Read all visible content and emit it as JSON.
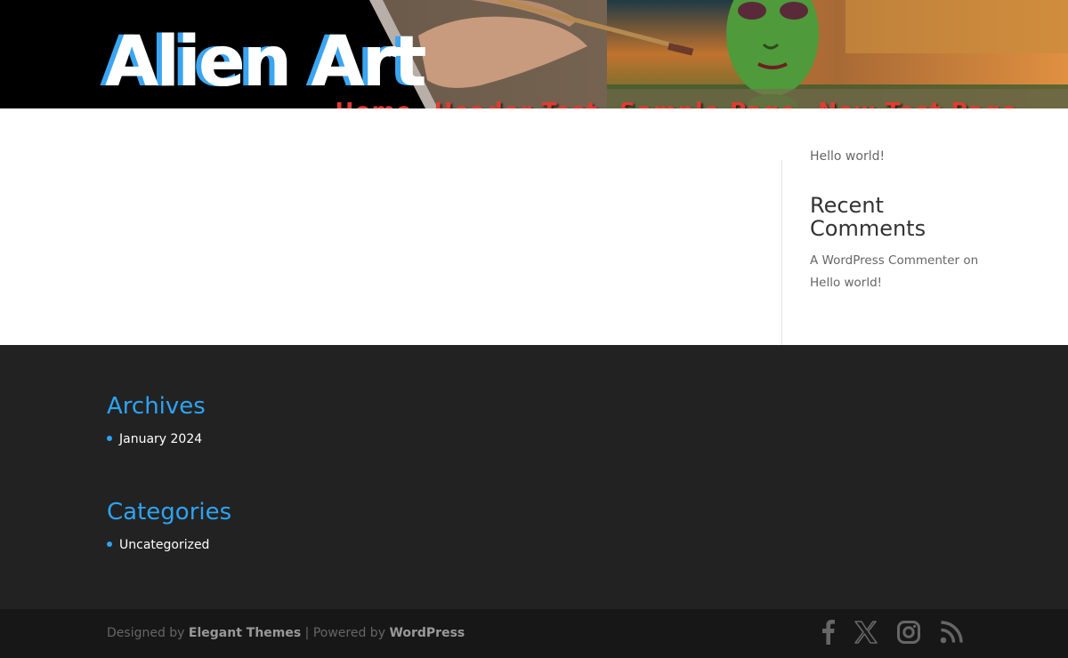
{
  "site": {
    "logo_text": "Alien Art"
  },
  "nav": {
    "items": [
      {
        "label": "Home"
      },
      {
        "label": "Header Test"
      },
      {
        "label": "Sample Page"
      },
      {
        "label": "New Test Page"
      }
    ]
  },
  "sidebar": {
    "cut_link": "Hello world!",
    "recent_comments": {
      "title": "Recent Comments",
      "comment_author": "A WordPress Commenter",
      "comment_on": "on",
      "comment_post": "Hello world!"
    }
  },
  "footer_widgets": {
    "archives": {
      "title": "Archives",
      "items": [
        "January 2024"
      ]
    },
    "categories": {
      "title": "Categories",
      "items": [
        "Uncategorized"
      ]
    }
  },
  "bottom_bar": {
    "designed_by": "Designed by",
    "theme_name": "Elegant Themes",
    "separator": "| Powered by",
    "platform": "WordPress",
    "social_icons": [
      "facebook-icon",
      "x-icon",
      "instagram-icon",
      "rss-icon"
    ]
  },
  "colors": {
    "accent": "#2ea3f2",
    "nav": "#e23b32",
    "footer_bg": "#222222",
    "bottom_bg": "#171717"
  }
}
